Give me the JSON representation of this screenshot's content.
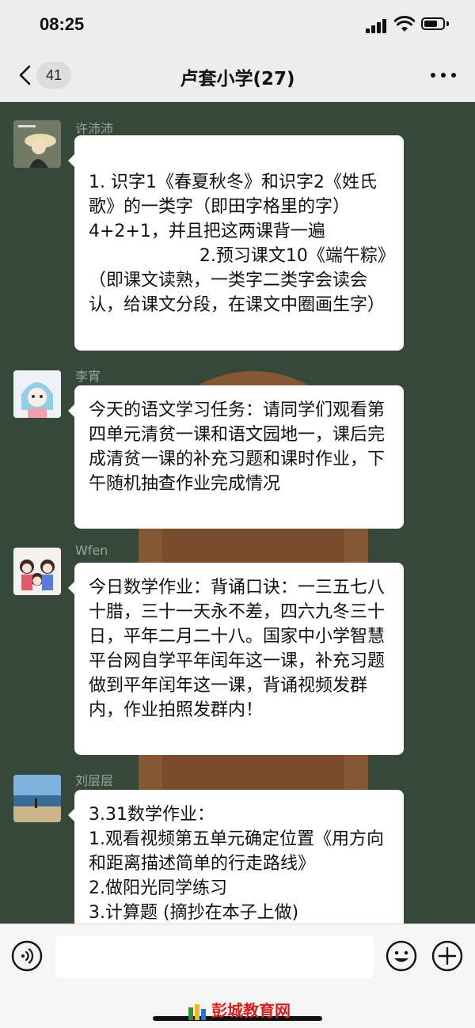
{
  "status_bar": {
    "time": "08:25"
  },
  "nav": {
    "unread_count": "41",
    "title": "卢套小学(27)"
  },
  "messages": [
    {
      "sender": "许沛沛",
      "text": "1. 识字1《春夏秋冬》和识字2《姓氏歌》的一类字（即田字格里的字）4+2+1，并且把这两课背一遍\n                    2.预习课文10《端午粽》（即课文读熟，一类字二类字会读会认，给课文分段，在课文中圈画生字）"
    },
    {
      "sender": "李宵",
      "text": "今天的语文学习任务：请同学们观看第四单元清贫一课和语文园地一，课后完成清贫一课的补充习题和课时作业，下午随机抽查作业完成情况"
    },
    {
      "sender": "Wfen",
      "text": "今日数学作业：背诵口诀：一三五七八十腊，三十一天永不差，四六九冬三十日，平年二月二十八。国家中小学智慧平台网自学平年闰年这一课，补充习题做到平年闰年这一课，背诵视频发群内，作业拍照发群内！"
    },
    {
      "sender": "刘层层",
      "text": "3.31数学作业：\n1.观看视频第五单元确定位置《用方向和距离描述简单的行走路线》\n2.做阳光同学练习\n3.计算题 (摘抄在本子上做)"
    }
  ],
  "input": {
    "value": ""
  },
  "watermark": {
    "text": "彭城教育网"
  },
  "colors": {
    "chat_background": "#35483a",
    "bubble": "#ffffff",
    "bar": "#ededed"
  }
}
